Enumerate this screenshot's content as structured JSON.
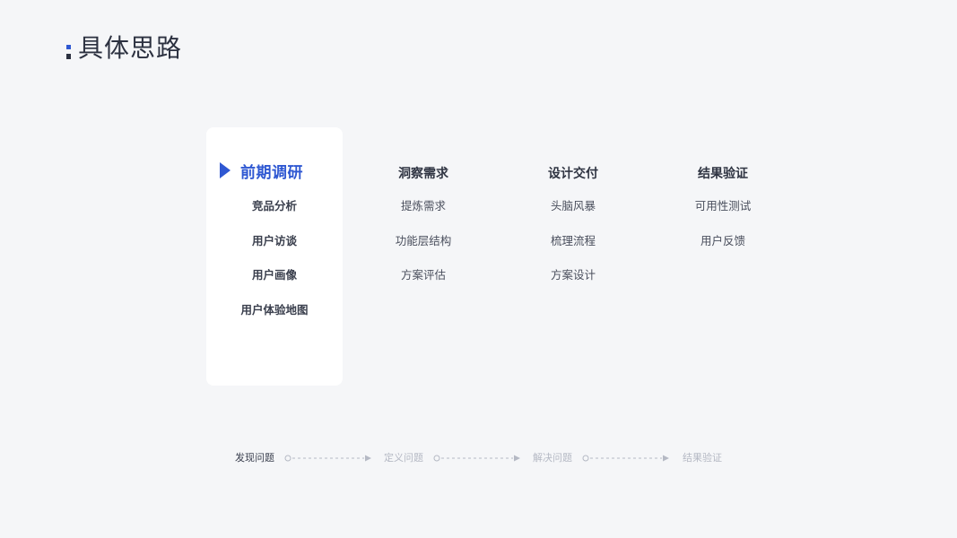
{
  "page": {
    "title": "具体思路"
  },
  "colors": {
    "accent": "#2f58d2",
    "background": "#f5f6f8",
    "card": "#ffffff",
    "text": "#2f3442",
    "muted": "#b5b9c4"
  },
  "stages": [
    {
      "title": "前期调研",
      "active": true,
      "icon": "play-arrow-icon",
      "items": [
        "竞品分析",
        "用户访谈",
        "用户画像",
        "用户体验地图"
      ]
    },
    {
      "title": "洞察需求",
      "active": false,
      "items": [
        "提炼需求",
        "功能层结构",
        "方案评估"
      ]
    },
    {
      "title": "设计交付",
      "active": false,
      "items": [
        "头脑风暴",
        "梳理流程",
        "方案设计"
      ]
    },
    {
      "title": "结果验证",
      "active": false,
      "items": [
        "可用性测试",
        "用户反馈"
      ]
    }
  ],
  "flow": {
    "steps": [
      "发现问题",
      "定义问题",
      "解决问题",
      "结果验证"
    ],
    "active_index": 0
  }
}
